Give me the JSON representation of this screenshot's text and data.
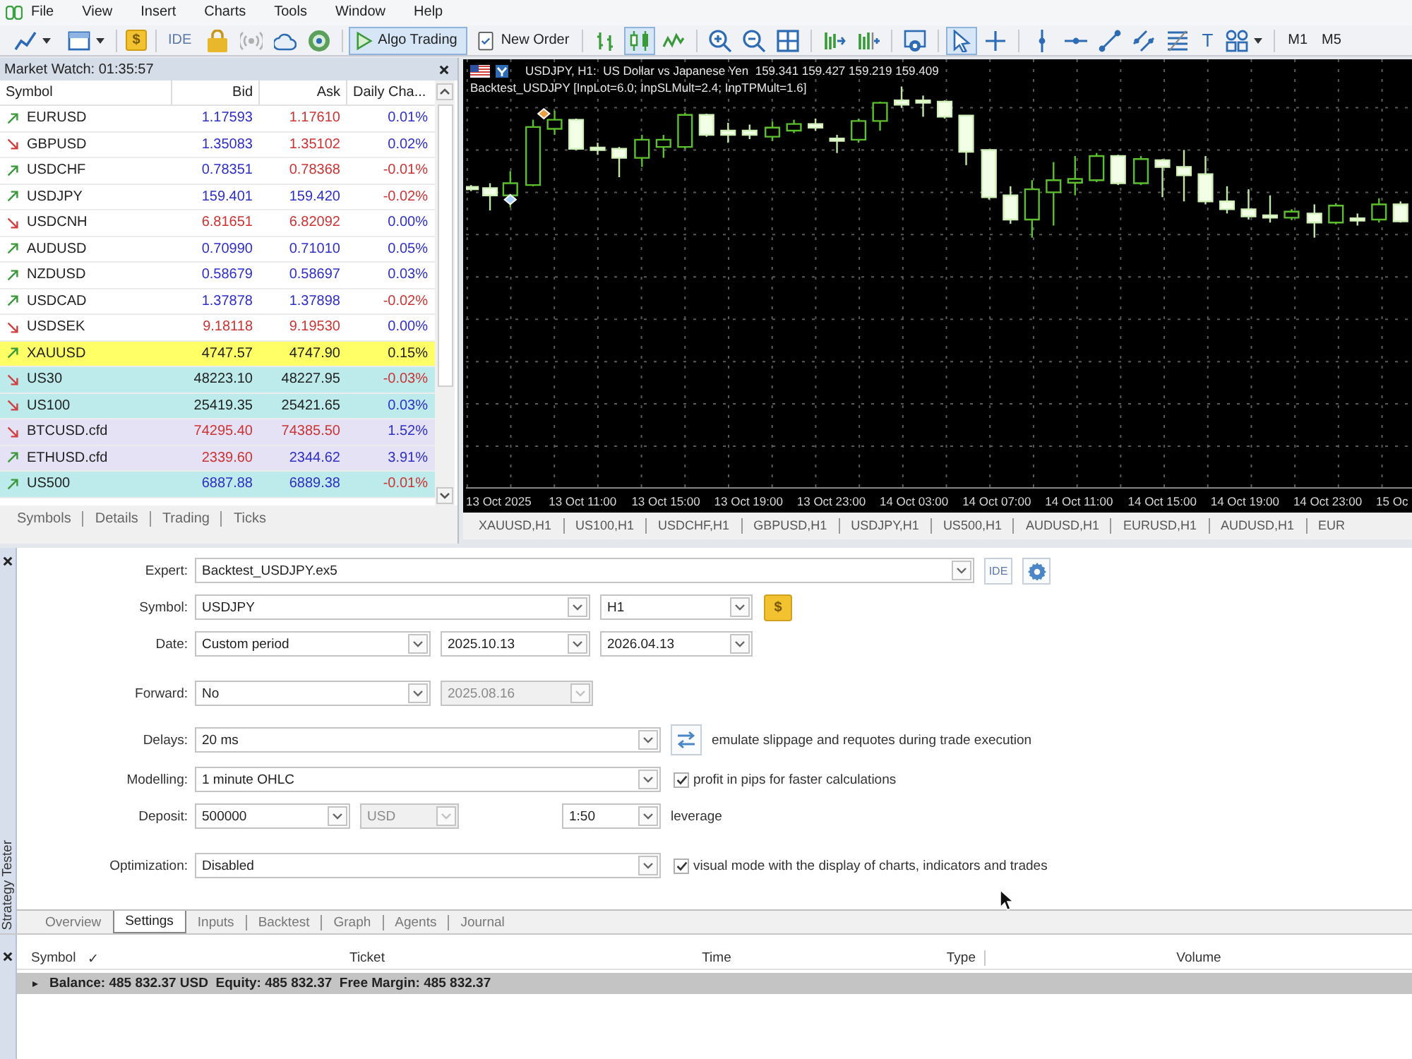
{
  "menu_bar": {
    "items": [
      "File",
      "View",
      "Insert",
      "Charts",
      "Tools",
      "Window",
      "Help"
    ]
  },
  "toolbar": {
    "currency": "$",
    "ide": "IDE",
    "algo_trading": {
      "label": "Algo Trading",
      "on": true
    },
    "new_order": "New Order",
    "chart_types": [
      {
        "selected": false
      },
      {
        "selected": true
      },
      {
        "selected": false
      }
    ],
    "cursor_tools": [
      {
        "selected": true
      },
      {
        "selected": false
      }
    ],
    "text_tool": "T",
    "timeframes": [
      "M1",
      "M5"
    ]
  },
  "market_watch": {
    "title": "Market Watch: 01:35:57",
    "columns": [
      "Symbol",
      "Bid",
      "Ask",
      "Daily Cha..."
    ],
    "rows": [
      {
        "kind": "up",
        "symbol": "EURUSD",
        "color": "#ffffff",
        "bid": {
          "text": "1.17593",
          "color": "#2e2ec8"
        },
        "ask": {
          "text": "1.17610",
          "color": "#cc3333"
        },
        "change": {
          "text": "0.01%",
          "color": "#2e2ec8"
        }
      },
      {
        "kind": "down",
        "symbol": "GBPUSD",
        "color": "#ffffff",
        "bid": {
          "text": "1.35083",
          "color": "#2e2ec8"
        },
        "ask": {
          "text": "1.35102",
          "color": "#cc3333"
        },
        "change": {
          "text": "0.02%",
          "color": "#2e2ec8"
        }
      },
      {
        "kind": "up",
        "symbol": "USDCHF",
        "color": "#ffffff",
        "bid": {
          "text": "0.78351",
          "color": "#2e2ec8"
        },
        "ask": {
          "text": "0.78368",
          "color": "#cc3333"
        },
        "change": {
          "text": "-0.01%",
          "color": "#cc3333"
        }
      },
      {
        "kind": "up",
        "symbol": "USDJPY",
        "color": "#ffffff",
        "bid": {
          "text": "159.401",
          "color": "#2e2ec8"
        },
        "ask": {
          "text": "159.420",
          "color": "#2e2ec8"
        },
        "change": {
          "text": "-0.02%",
          "color": "#cc3333"
        }
      },
      {
        "kind": "down",
        "symbol": "USDCNH",
        "color": "#ffffff",
        "bid": {
          "text": "6.81651",
          "color": "#cc3333"
        },
        "ask": {
          "text": "6.82092",
          "color": "#cc3333"
        },
        "change": {
          "text": "0.00%",
          "color": "#2e2ec8"
        }
      },
      {
        "kind": "up",
        "symbol": "AUDUSD",
        "color": "#ffffff",
        "bid": {
          "text": "0.70990",
          "color": "#2e2ec8"
        },
        "ask": {
          "text": "0.71010",
          "color": "#2e2ec8"
        },
        "change": {
          "text": "0.05%",
          "color": "#2e2ec8"
        }
      },
      {
        "kind": "up",
        "symbol": "NZDUSD",
        "color": "#ffffff",
        "bid": {
          "text": "0.58679",
          "color": "#2e2ec8"
        },
        "ask": {
          "text": "0.58697",
          "color": "#2e2ec8"
        },
        "change": {
          "text": "0.03%",
          "color": "#2e2ec8"
        }
      },
      {
        "kind": "up",
        "symbol": "USDCAD",
        "color": "#ffffff",
        "bid": {
          "text": "1.37878",
          "color": "#2e2ec8"
        },
        "ask": {
          "text": "1.37898",
          "color": "#2e2ec8"
        },
        "change": {
          "text": "-0.02%",
          "color": "#cc3333"
        }
      },
      {
        "kind": "down",
        "symbol": "USDSEK",
        "color": "#ffffff",
        "bid": {
          "text": "9.18118",
          "color": "#cc3333"
        },
        "ask": {
          "text": "9.19530",
          "color": "#cc3333"
        },
        "change": {
          "text": "0.00%",
          "color": "#2e2ec8"
        }
      },
      {
        "kind": "up",
        "symbol": "XAUUSD",
        "color": "#ffff66",
        "bid": {
          "text": "4747.57",
          "color": "#222222"
        },
        "ask": {
          "text": "4747.90",
          "color": "#222222"
        },
        "change": {
          "text": "0.15%",
          "color": "#222222"
        }
      },
      {
        "kind": "down",
        "symbol": "US30",
        "color": "#bdeaea",
        "bid": {
          "text": "48223.10",
          "color": "#222222"
        },
        "ask": {
          "text": "48227.95",
          "color": "#222222"
        },
        "change": {
          "text": "-0.03%",
          "color": "#cc3333"
        }
      },
      {
        "kind": "down",
        "symbol": "US100",
        "color": "#bdeaea",
        "bid": {
          "text": "25419.35",
          "color": "#222222"
        },
        "ask": {
          "text": "25421.65",
          "color": "#222222"
        },
        "change": {
          "text": "0.03%",
          "color": "#2e2ec8"
        }
      },
      {
        "kind": "down",
        "symbol": "BTCUSD.cfd",
        "color": "#e6e2f6",
        "bid": {
          "text": "74295.40",
          "color": "#cc3333"
        },
        "ask": {
          "text": "74385.50",
          "color": "#cc3333"
        },
        "change": {
          "text": "1.52%",
          "color": "#2e2ec8"
        }
      },
      {
        "kind": "up",
        "symbol": "ETHUSD.cfd",
        "color": "#e6e2f6",
        "bid": {
          "text": "2339.60",
          "color": "#cc3333"
        },
        "ask": {
          "text": "2344.62",
          "color": "#2e2ec8"
        },
        "change": {
          "text": "3.91%",
          "color": "#2e2ec8"
        }
      },
      {
        "kind": "up",
        "symbol": "US500",
        "color": "#bdeaea",
        "bid": {
          "text": "6887.88",
          "color": "#2e2ec8"
        },
        "ask": {
          "text": "6889.38",
          "color": "#2e2ec8"
        },
        "change": {
          "text": "-0.01%",
          "color": "#cc3333"
        }
      }
    ],
    "tabs": [
      "Symbols",
      "Details",
      "Trading",
      "Ticks"
    ]
  },
  "chart": {
    "title": "USDJPY, H1:  US Dollar vs Japanese Yen  159.341 159.427 159.219 159.409",
    "expert": "Backtest_USDJPY [InpLot=6.0; InpSLMult=2.4; InpTPMult=1.6]",
    "time_labels": [
      "13 Oct 2025",
      "13 Oct 11:00",
      "13 Oct 15:00",
      "13 Oct 19:00",
      "13 Oct 23:00",
      "14 Oct 03:00",
      "14 Oct 07:00",
      "14 Oct 11:00",
      "14 Oct 15:00",
      "14 Oct 19:00",
      "14 Oct 23:00",
      "15 Oc"
    ],
    "tabs": [
      "XAUUSD,H1",
      "US100,H1",
      "USDCHF,H1",
      "GBPUSD,H1",
      "USDJPY,H1",
      "US500,H1",
      "AUDUSD,H1",
      "EURUSD,H1",
      "AUDUSD,H1",
      "EUR"
    ]
  },
  "strategy_tester": {
    "caption": "Strategy Tester",
    "rows": [
      {
        "label": "Expert:",
        "fields": [
          {
            "value": "Backtest_USDJPY.ex5",
            "disabled": false
          }
        ],
        "buttons": [
          {
            "kind": "ide",
            "label": "IDE"
          },
          {
            "kind": "gear"
          }
        ]
      },
      {
        "label": "Symbol:",
        "fields": [
          {
            "value": "USDJPY",
            "disabled": false
          },
          {
            "value": "H1",
            "disabled": false
          }
        ],
        "buttons": [
          {
            "kind": "currency",
            "label": "$"
          }
        ]
      },
      {
        "label": "Date:",
        "fields": [
          {
            "value": "Custom period",
            "disabled": false
          },
          {
            "value": "2025.10.13",
            "disabled": false
          },
          {
            "value": "2026.04.13",
            "disabled": false
          }
        ]
      },
      {
        "label": "Forward:",
        "fields": [
          {
            "value": "No",
            "disabled": false
          },
          {
            "value": "2025.08.16",
            "disabled": true
          }
        ]
      },
      {
        "label": "Delays:",
        "fields": [
          {
            "value": "20 ms",
            "disabled": false
          }
        ],
        "buttons": [
          {
            "kind": "swap"
          }
        ],
        "note": "emulate slippage and requotes during trade execution"
      },
      {
        "label": "Modelling:",
        "fields": [
          {
            "value": "1 minute OHLC",
            "disabled": false
          }
        ],
        "option": {
          "label": "profit in pips for faster calculations",
          "checked": true
        }
      },
      {
        "label": "Deposit:",
        "fields": [
          {
            "value": "500000",
            "disabled": false
          },
          {
            "value": "USD",
            "disabled": true
          },
          {
            "value": "1:50",
            "disabled": false
          }
        ],
        "note": "leverage"
      },
      {
        "label": "Optimization:",
        "fields": [
          {
            "value": "Disabled",
            "disabled": false
          }
        ],
        "option": {
          "label": "visual mode with the display of charts, indicators and trades",
          "checked": true
        }
      }
    ],
    "tabs": [
      {
        "label": "Overview",
        "selected": false
      },
      {
        "label": "Settings",
        "selected": true
      },
      {
        "label": "Inputs",
        "selected": false
      },
      {
        "label": "Backtest",
        "selected": false
      },
      {
        "label": "Graph",
        "selected": false
      },
      {
        "label": "Agents",
        "selected": false
      },
      {
        "label": "Journal",
        "selected": false
      }
    ]
  },
  "toolbox": {
    "columns": [
      "Symbol",
      "✓",
      "Ticket",
      "Time",
      "Type",
      "Volume"
    ],
    "summary": "Balance: 485 832.37 USD  Equity: 485 832.37  Free Margin: 485 832.37"
  }
}
